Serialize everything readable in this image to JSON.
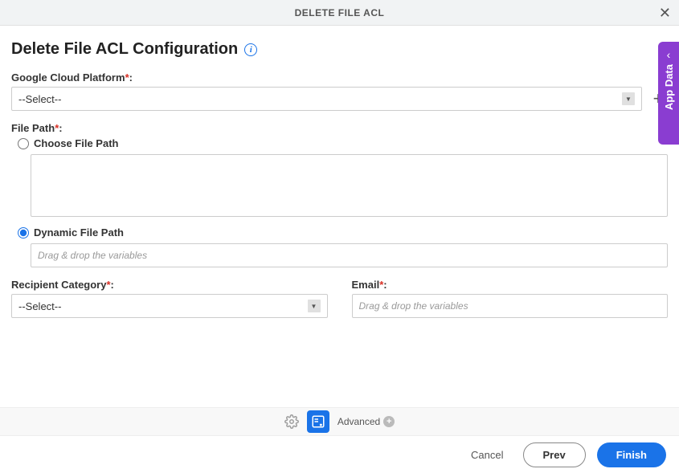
{
  "header": {
    "title": "DELETE FILE ACL"
  },
  "page": {
    "title": "Delete File ACL Configuration"
  },
  "gcp": {
    "label": "Google Cloud Platform",
    "value": "--Select--"
  },
  "filePath": {
    "label": "File Path",
    "chooseLabel": "Choose File Path",
    "dynamicLabel": "Dynamic File Path",
    "dynamicPlaceholder": "Drag & drop the variables",
    "selected": "dynamic"
  },
  "recipientCategory": {
    "label": "Recipient Category",
    "value": "--Select--"
  },
  "email": {
    "label": "Email",
    "placeholder": "Drag & drop the variables"
  },
  "toolbar": {
    "advanced": "Advanced"
  },
  "footer": {
    "cancel": "Cancel",
    "prev": "Prev",
    "finish": "Finish"
  },
  "sideTab": {
    "label": "App Data"
  }
}
